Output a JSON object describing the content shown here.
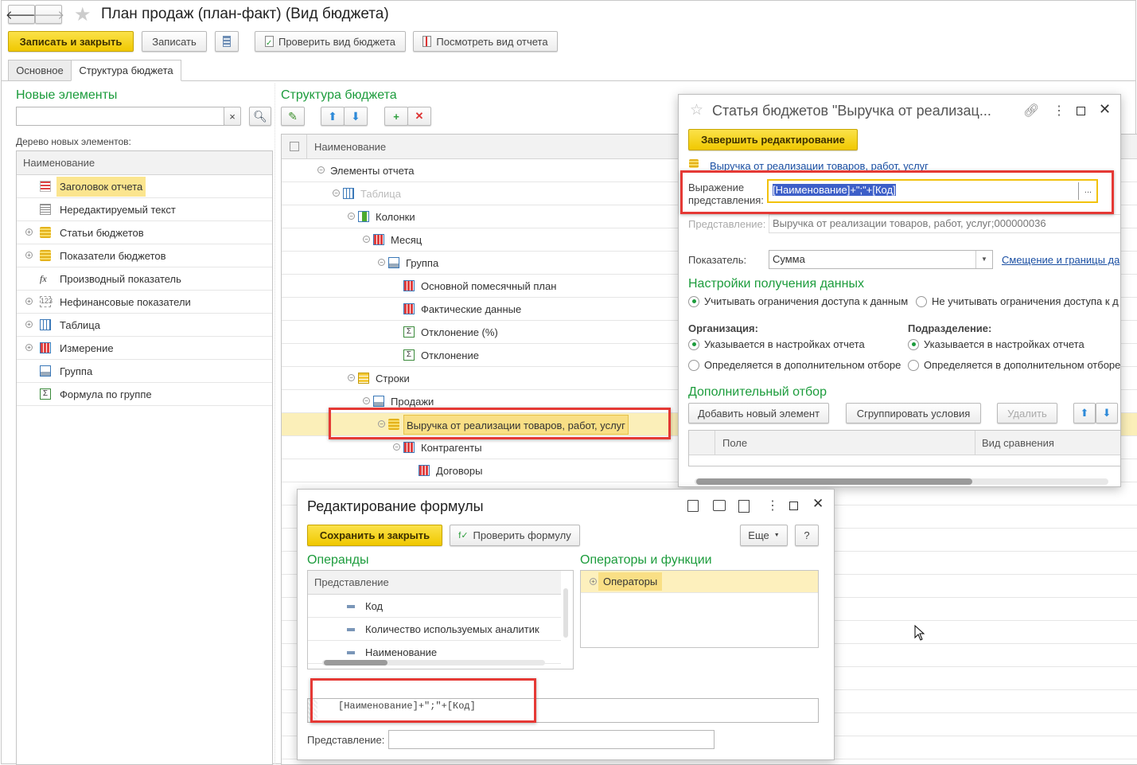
{
  "window": {
    "title": "План продаж (план-факт) (Вид бюджета)",
    "nav_back": "🡐",
    "nav_forward": "🡒"
  },
  "toolbar": {
    "save_close": "Записать и закрыть",
    "save": "Записать",
    "check_budget": "Проверить вид бюджета",
    "view_report": "Посмотреть вид отчета"
  },
  "tabs": [
    {
      "label": "Основное",
      "active": false
    },
    {
      "label": "Структура бюджета",
      "active": true
    }
  ],
  "left": {
    "title": "Новые элементы",
    "search_value": "",
    "clear": "×",
    "tree_label": "Дерево новых элементов:",
    "column": "Наименование",
    "items": [
      {
        "label": "Заголовок отчета",
        "icon": "report-header-icon",
        "expandable": false,
        "selected": true
      },
      {
        "label": "Нередактируемый текст",
        "icon": "text-icon",
        "expandable": false
      },
      {
        "label": "Статьи бюджетов",
        "icon": "coins-icon",
        "expandable": true
      },
      {
        "label": "Показатели бюджетов",
        "icon": "coins-icon",
        "expandable": true
      },
      {
        "label": "Производный показатель",
        "icon": "fx-icon",
        "expandable": false
      },
      {
        "label": "Нефинансовые показатели",
        "icon": "number-icon",
        "expandable": true
      },
      {
        "label": "Таблица",
        "icon": "table-icon",
        "expandable": true
      },
      {
        "label": "Измерение",
        "icon": "grid-icon",
        "expandable": true
      },
      {
        "label": "Группа",
        "icon": "group-icon",
        "expandable": false
      },
      {
        "label": "Формула по группе",
        "icon": "sum-icon",
        "expandable": false
      }
    ]
  },
  "center": {
    "title": "Структура бюджета",
    "column": "Наименование",
    "items": [
      {
        "label": "Элементы отчета",
        "level": 0,
        "expand": true,
        "icon": ""
      },
      {
        "label": "Таблица",
        "level": 1,
        "expand": true,
        "icon": "table-icon",
        "muted": true
      },
      {
        "label": "Колонки",
        "level": 2,
        "expand": true,
        "icon": "columns-icon"
      },
      {
        "label": "Месяц",
        "level": 3,
        "expand": true,
        "icon": "grid-icon"
      },
      {
        "label": "Группа",
        "level": 4,
        "expand": true,
        "icon": "group-icon"
      },
      {
        "label": "Основной помесячный план",
        "level": 5,
        "expand": false,
        "icon": "grid-icon"
      },
      {
        "label": "Фактические данные",
        "level": 5,
        "expand": false,
        "icon": "grid-icon"
      },
      {
        "label": "Отклонение (%)",
        "level": 5,
        "expand": false,
        "icon": "sum-icon"
      },
      {
        "label": "Отклонение",
        "level": 5,
        "expand": false,
        "icon": "sum-icon"
      },
      {
        "label": "Строки",
        "level": 2,
        "expand": true,
        "icon": "rows-icon"
      },
      {
        "label": "Продажи",
        "level": 3,
        "expand": true,
        "icon": "group-icon"
      },
      {
        "label": "Выручка от реализации товаров, работ, услуг",
        "level": 4,
        "expand": true,
        "icon": "coins-icon",
        "selected": true
      },
      {
        "label": "Контрагенты",
        "level": 5,
        "expand": true,
        "icon": "grid-icon"
      },
      {
        "label": "Договоры",
        "level": 6,
        "expand": false,
        "icon": "grid-icon"
      }
    ]
  },
  "article_dialog": {
    "title": "Статья бюджетов \"Выручка от реализац...",
    "finish": "Завершить редактирование",
    "article_link": "Выручка от реализации товаров, работ, услуг",
    "expr_label": "Выражение представления:",
    "expr_value": "[Наименование]+\";\"+[Код]",
    "expr_btn": "...",
    "repr_label": "Представление:",
    "repr_value": "Выручка от реализации товаров, работ, услуг;000000036",
    "indicator_label": "Показатель:",
    "indicator_value": "Сумма",
    "offset_link": "Смещение и границы да",
    "data_settings_title": "Настройки получения данных",
    "access_yes": "Учитывать ограничения доступа к данным",
    "access_no": "Не  учитывать ограничения доступа к д",
    "org_label": "Организация:",
    "org_opt1": "Указывается в настройках отчета",
    "org_opt2": "Определяется в дополнительном отборе",
    "dep_label": "Подразделение:",
    "dep_opt1": "Указывается в настройках отчета",
    "dep_opt2": "Определяется в дополнительном отборе",
    "filter_title": "Дополнительный отбор",
    "add_element": "Добавить новый элемент",
    "group_conditions": "Сгруппировать условия",
    "delete": "Удалить",
    "col_field": "Поле",
    "col_compare": "Вид сравнения"
  },
  "formula_dialog": {
    "title": "Редактирование формулы",
    "save_close": "Сохранить и закрыть",
    "check": "Проверить формулу",
    "more": "Еще",
    "help": "?",
    "operands_title": "Операнды",
    "operators_title": "Операторы и функции",
    "operands_column": "Представление",
    "operands": [
      "Код",
      "Количество используемых аналитик",
      "Наименование"
    ],
    "operators": [
      "Операторы"
    ],
    "formula": "[Наименование]+\";\"+[Код]",
    "repr_label": "Представление:",
    "repr_value": ""
  },
  "colors": {
    "accent_green": "#1c9c3c",
    "button_yellow": "#f5d21a",
    "highlight_red": "#e53935",
    "selection": "#fbefb9"
  }
}
